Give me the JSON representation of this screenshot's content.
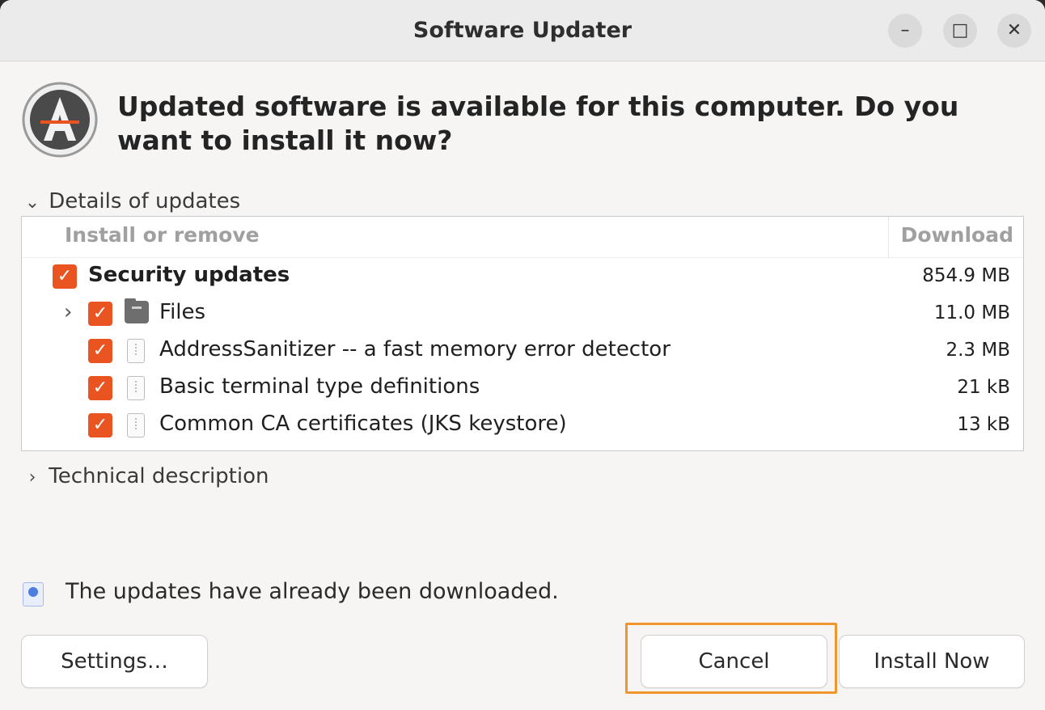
{
  "window": {
    "title": "Software Updater",
    "controls": {
      "minimize": "–",
      "maximize": "□",
      "close": "✕"
    }
  },
  "headline": "Updated software is available for this computer. Do you want to install it now?",
  "details_expander": {
    "label": "Details of updates",
    "expanded": true
  },
  "table": {
    "columns": {
      "name": "Install or remove",
      "size": "Download"
    },
    "rows": [
      {
        "name": "Security updates",
        "size": "854.9 MB",
        "checked": true
      },
      {
        "name": "Files",
        "size": "11.0 MB",
        "checked": true
      },
      {
        "name": "AddressSanitizer -- a fast memory error detector",
        "size": "2.3 MB",
        "checked": true
      },
      {
        "name": "Basic terminal type definitions",
        "size": "21 kB",
        "checked": true
      },
      {
        "name": "Common CA certificates (JKS keystore)",
        "size": "13 kB",
        "checked": true
      }
    ]
  },
  "technical_expander": {
    "label": "Technical description",
    "expanded": false
  },
  "status_text": "The updates have already been downloaded.",
  "buttons": {
    "settings": "Settings…",
    "cancel": "Cancel",
    "install": "Install Now"
  },
  "colors": {
    "accent": "#e95420",
    "highlight": "#f0962e"
  },
  "icons": {
    "app": "software-updater-icon",
    "expander_open": "chevron-down-icon",
    "expander_closed": "chevron-right-icon",
    "folder": "folder-icon",
    "package": "package-icon",
    "status": "download-info-icon"
  }
}
